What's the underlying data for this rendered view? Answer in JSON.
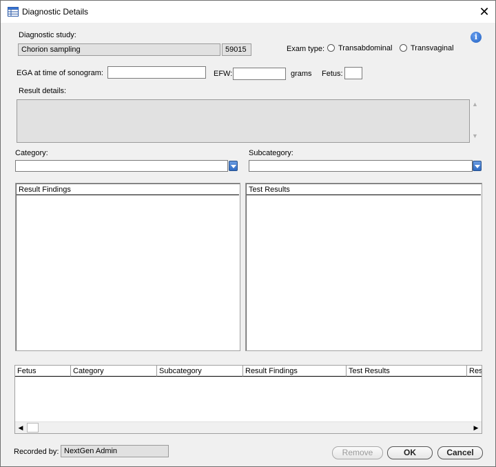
{
  "window": {
    "title": "Diagnostic Details",
    "icon": "table-icon",
    "close_label": "✕"
  },
  "study": {
    "label": "Diagnostic study:",
    "name": "Chorion sampling",
    "code": "59015"
  },
  "exam_type": {
    "label": "Exam type:",
    "options": [
      "Transabdominal",
      "Transvaginal"
    ],
    "selected": null
  },
  "info": {
    "glyph": "i"
  },
  "ega": {
    "label": "EGA at time of sonogram:",
    "value": ""
  },
  "efw": {
    "label": "EFW:",
    "value": "",
    "unit": "grams"
  },
  "fetus": {
    "label": "Fetus:",
    "value": ""
  },
  "result_details": {
    "label": "Result details:",
    "value": ""
  },
  "category": {
    "label": "Category:",
    "value": ""
  },
  "subcategory": {
    "label": "Subcategory:",
    "value": ""
  },
  "panels": {
    "result_findings": "Result Findings",
    "test_results": "Test Results"
  },
  "grid": {
    "columns": [
      "Fetus",
      "Category",
      "Subcategory",
      "Result Findings",
      "Test Results",
      "Resu"
    ]
  },
  "recorded_by": {
    "label": "Recorded by:",
    "value": "NextGen Admin"
  },
  "buttons": {
    "remove": "Remove",
    "ok": "OK",
    "cancel": "Cancel"
  }
}
